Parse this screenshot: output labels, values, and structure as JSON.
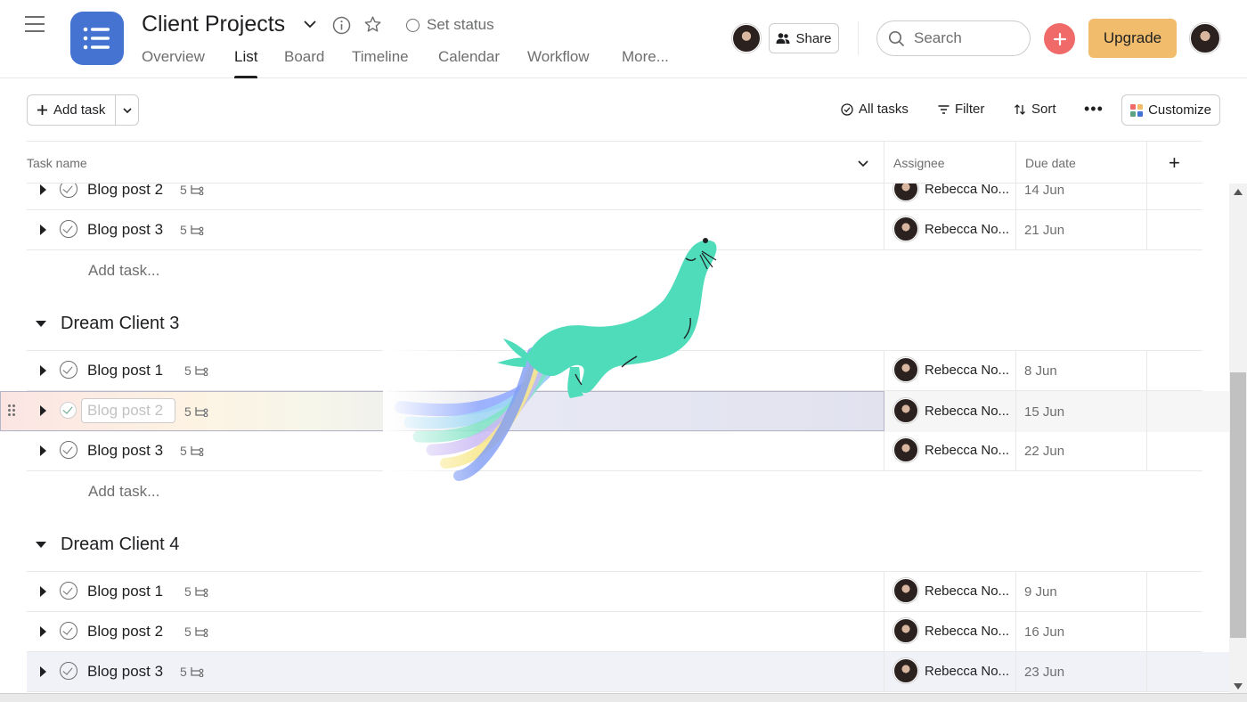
{
  "header": {
    "project_title": "Client Projects",
    "set_status": "Set status",
    "share_label": "Share",
    "search_placeholder": "Search",
    "upgrade_label": "Upgrade",
    "tabs": [
      "Overview",
      "List",
      "Board",
      "Timeline",
      "Calendar",
      "Workflow",
      "More..."
    ],
    "active_tab": "List"
  },
  "toolbar": {
    "add_task": "Add task",
    "all_tasks": "All tasks",
    "filter": "Filter",
    "sort": "Sort",
    "more": "•••",
    "customize": "Customize"
  },
  "columns": {
    "task_name": "Task name",
    "assignee": "Assignee",
    "due_date": "Due date",
    "add_column": "+"
  },
  "top_rows": [
    {
      "name": "Blog post 2",
      "subtasks": "5",
      "assignee": "Rebecca No...",
      "due": "14 Jun"
    },
    {
      "name": "Blog post 3",
      "subtasks": "5",
      "assignee": "Rebecca No...",
      "due": "21 Jun"
    }
  ],
  "add_task_link": "Add task...",
  "sections": [
    {
      "name": "Dream Client 3",
      "rows": [
        {
          "name": "Blog post 1",
          "subtasks": "5",
          "assignee": "Rebecca No...",
          "due": "8 Jun"
        },
        {
          "name": "Blog post 2",
          "subtasks": "5",
          "assignee": "Rebecca No...",
          "due": "15 Jun",
          "dragging": true
        },
        {
          "name": "Blog post 3",
          "subtasks": "5",
          "assignee": "Rebecca No...",
          "due": "22 Jun"
        }
      ]
    },
    {
      "name": "Dream Client 4",
      "rows": [
        {
          "name": "Blog post 1",
          "subtasks": "5",
          "assignee": "Rebecca No...",
          "due": "9 Jun"
        },
        {
          "name": "Blog post 2",
          "subtasks": "5",
          "assignee": "Rebecca No...",
          "due": "16 Jun"
        },
        {
          "name": "Blog post 3",
          "subtasks": "5",
          "assignee": "Rebecca No...",
          "due": "23 Jun",
          "highlighted": true
        }
      ]
    }
  ],
  "colors": {
    "app_icon": "#4573d2",
    "add_button": "#f06a6a",
    "upgrade": "#f1bd6c",
    "sea_lion": "#4fdcbb"
  },
  "icons": [
    "hamburger-icon",
    "list-icon",
    "chevron-down-icon",
    "info-icon",
    "star-icon",
    "status-ring-icon",
    "people-icon",
    "search-icon",
    "plus-icon",
    "check-circle-icon",
    "filter-icon",
    "sort-icon",
    "customize-grid-icon",
    "subtask-icon",
    "drag-handle-icon",
    "sea-lion-illustration"
  ]
}
